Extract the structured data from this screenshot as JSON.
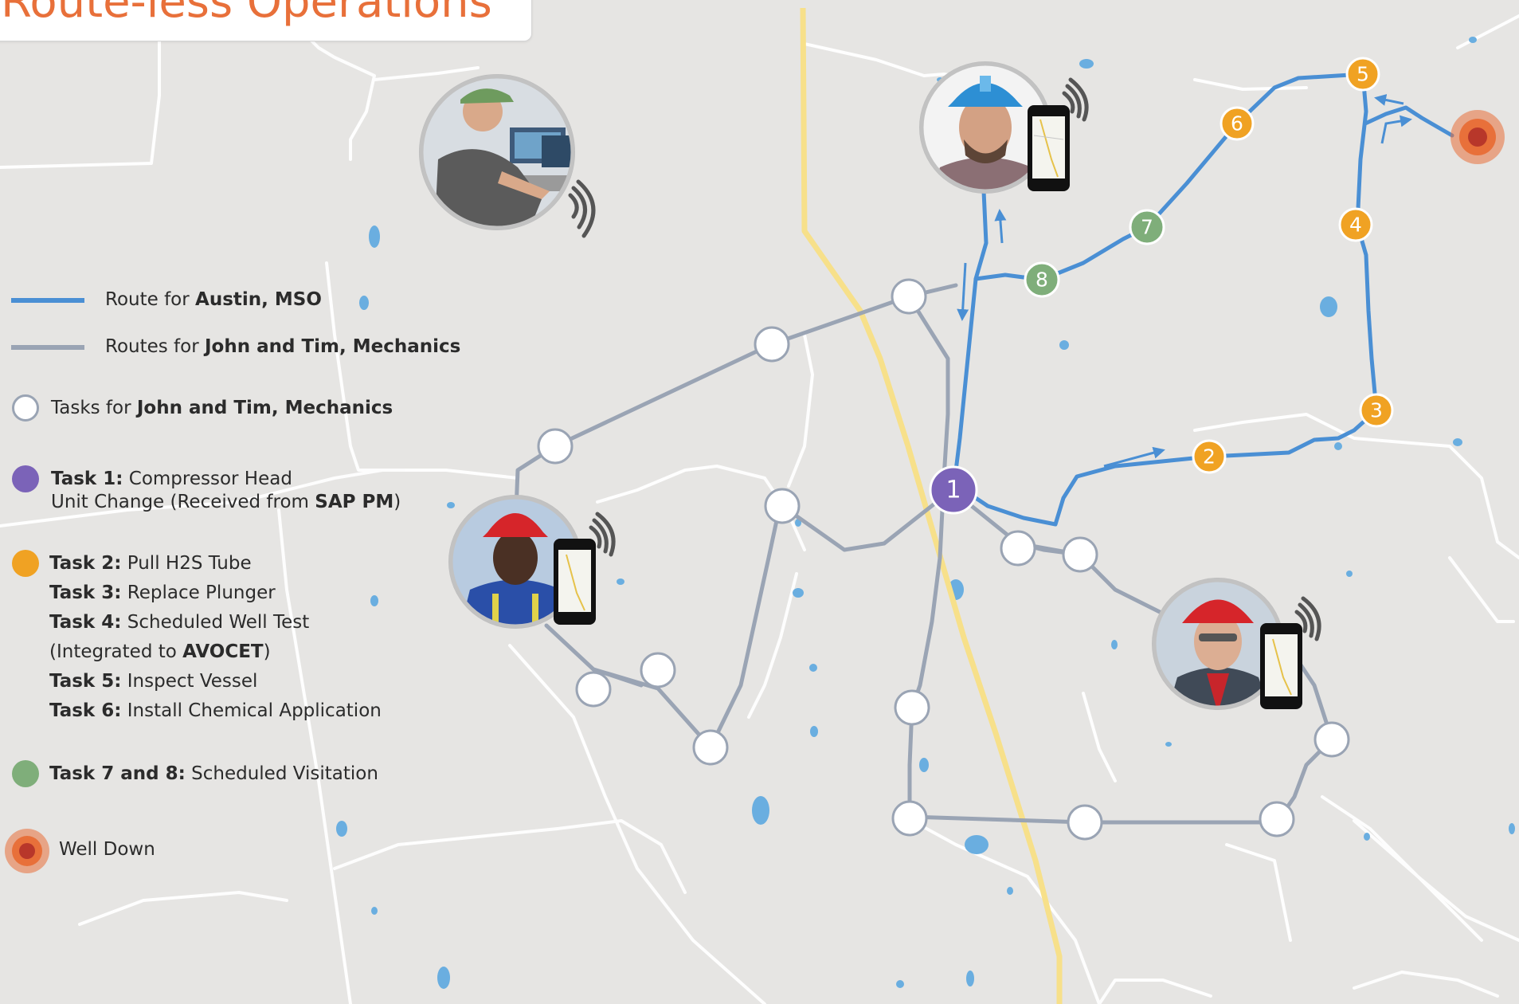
{
  "title": "Route-less Operations",
  "colors": {
    "blue_route": "#4a8fd4",
    "gray_route": "#9aa4b4",
    "highway": "#f7e08a",
    "purple": "#7b63b8",
    "orange": "#f0a223",
    "green": "#7fae7a",
    "well_down": "#e8703a"
  },
  "legend": {
    "blue_route": {
      "prefix": "Route for ",
      "name": "Austin",
      "role": ", MSO"
    },
    "gray_route": {
      "prefix": "Routes for ",
      "name": "John and Tim",
      "role": ", Mechanics"
    },
    "white_tasks": {
      "prefix": "Tasks for ",
      "name": "John and Tim",
      "role": ", Mechanics"
    },
    "task1": {
      "label": "Task 1:",
      "text": " Compressor Head",
      "line2_prefix": "Unit Change (Received from ",
      "line2_bold": "SAP PM",
      "line2_suffix": ")"
    },
    "orange_tasks": [
      {
        "label": "Task 2:",
        "text": " Pull H2S Tube"
      },
      {
        "label": "Task 3:",
        "text": " Replace Plunger"
      },
      {
        "label": "Task 4:",
        "text": " Scheduled Well Test"
      },
      {
        "label": "",
        "text": "(Integrated to ",
        "bold_tail": "AVOCET",
        "tail": ")"
      },
      {
        "label": "Task 5:",
        "text": " Inspect Vessel"
      },
      {
        "label": "Task 6:",
        "text": " Install Chemical Application"
      }
    ],
    "green_tasks": {
      "label": "Task 7 and 8:",
      "text": " Scheduled Visitation"
    },
    "well_down": "Well Down"
  },
  "numbered_tasks": [
    {
      "n": "1",
      "color": "purple"
    },
    {
      "n": "2",
      "color": "orange"
    },
    {
      "n": "3",
      "color": "orange"
    },
    {
      "n": "4",
      "color": "orange"
    },
    {
      "n": "5",
      "color": "orange"
    },
    {
      "n": "6",
      "color": "orange"
    },
    {
      "n": "7",
      "color": "green"
    },
    {
      "n": "8",
      "color": "green"
    }
  ],
  "people": [
    {
      "role": "operator-at-computer",
      "hat": "green cap",
      "device": "wireless signal"
    },
    {
      "role": "worker-blue-hardhat",
      "hat": "blue hardhat",
      "device": "smartphone"
    },
    {
      "role": "worker-red-hardhat-left",
      "hat": "red hardhat",
      "device": "smartphone"
    },
    {
      "role": "worker-red-hardhat-right",
      "hat": "red hardhat",
      "device": "smartphone"
    }
  ]
}
